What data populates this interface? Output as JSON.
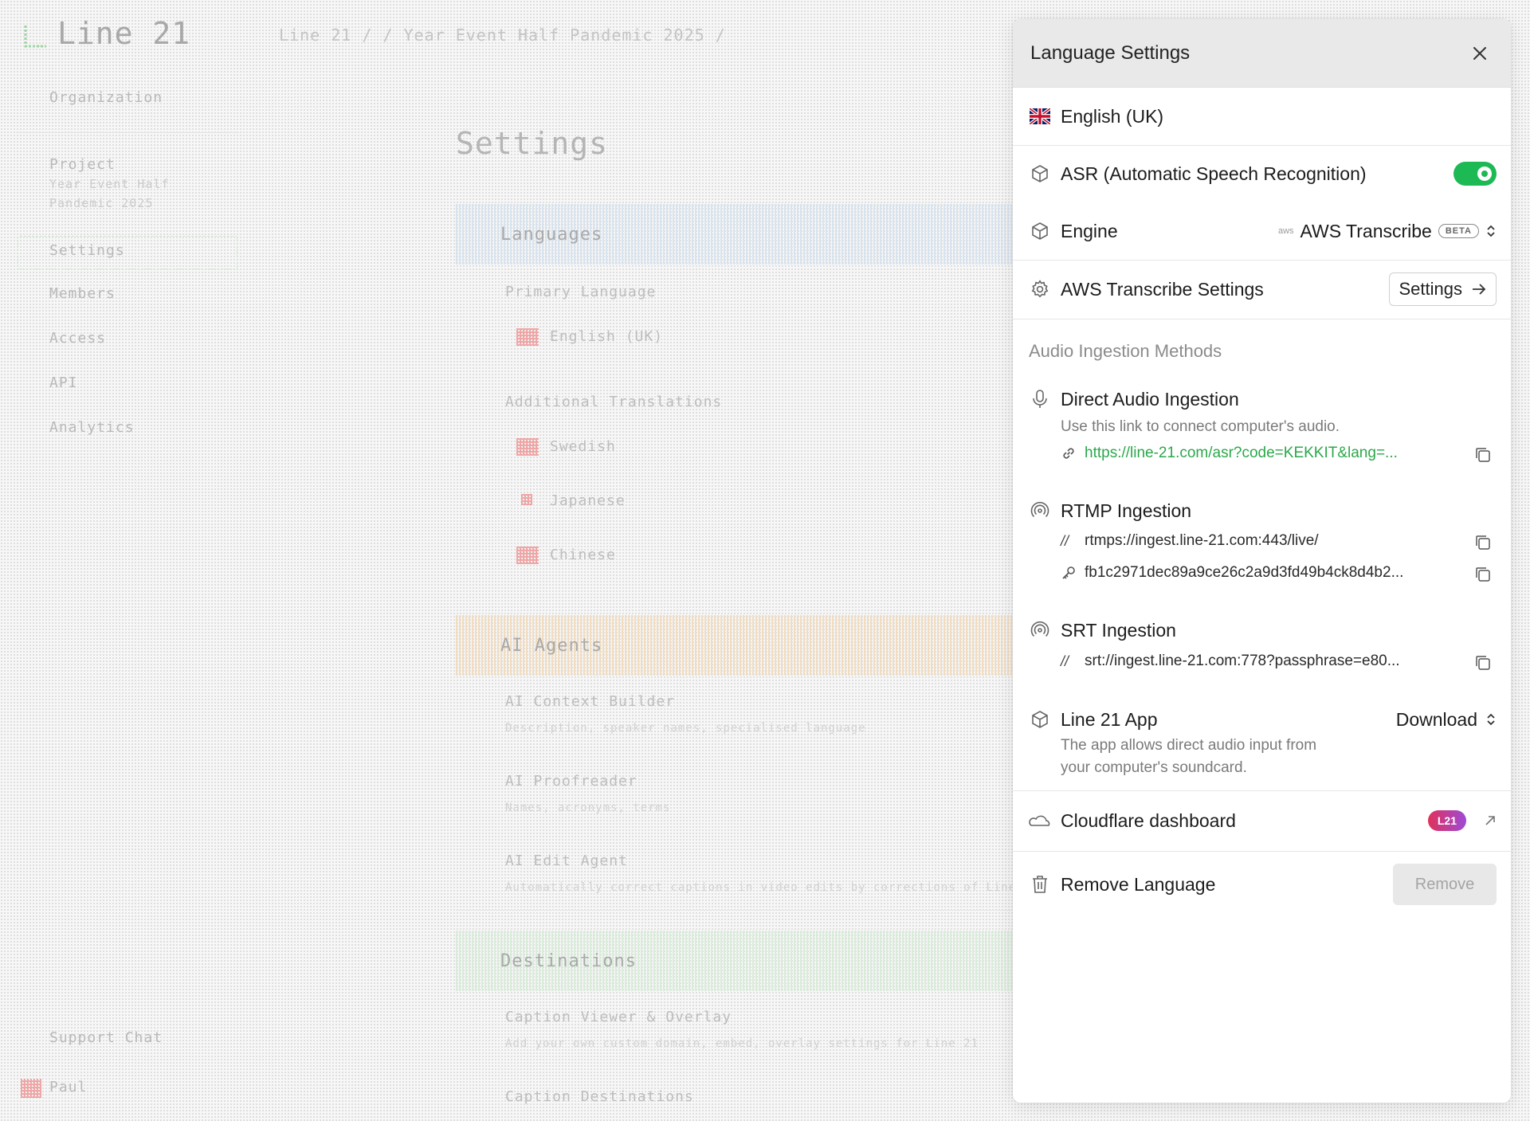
{
  "background": {
    "logo": "Line 21",
    "breadcrumb": "Line 21  /  /  Year Event Half Pandemic 2025  /",
    "sidebar": {
      "org": "Organization",
      "project": "Project",
      "project_sub1": "Year Event Half",
      "project_sub2": "Pandemic 2025",
      "items": [
        "Settings",
        "Members",
        "Access",
        "API",
        "Analytics"
      ],
      "support": "Support Chat",
      "user": "Paul"
    },
    "page_title": "Settings",
    "sections": [
      {
        "label": "Languages"
      },
      {
        "label": "AI Agents"
      },
      {
        "label": "Destinations"
      }
    ],
    "rows": {
      "primary_language": "Primary Language",
      "primary_value": "English (UK)",
      "additional": "Additional Translations",
      "lang1": "Swedish",
      "lang2": "Japanese",
      "lang3": "Chinese",
      "ai_context": "AI Context Builder",
      "ai_context_sub": "Description, speaker names, specialised language",
      "ai_proof": "AI Proofreader",
      "ai_proof_sub": "Names, acronyms, terms",
      "ai_edit": "AI Edit Agent",
      "ai_edit_sub": "Automatically correct captions in video edits by corrections of Line 21",
      "caption_viewer": "Caption Viewer & Overlay",
      "caption_viewer_sub": "Add your own custom domain, embed, overlay settings for Line 21",
      "caption_dest": "Caption Destinations"
    }
  },
  "drawer": {
    "title": "Language Settings",
    "language": "English (UK)",
    "asr_label": "ASR (Automatic Speech Recognition)",
    "asr_enabled": true,
    "engine_label": "Engine",
    "engine_value": "AWS Transcribe",
    "engine_aws_mini": "aws",
    "engine_badge": "BETA",
    "aws_settings_label": "AWS Transcribe Settings",
    "aws_settings_button": "Settings",
    "ingestion_heading": "Audio Ingestion Methods",
    "direct": {
      "title": "Direct Audio Ingestion",
      "desc": "Use this link to connect computer's audio.",
      "link": "https://line-21.com/asr?code=KEKKIT&lang=..."
    },
    "rtmp": {
      "title": "RTMP Ingestion",
      "url": "rtmps://ingest.line-21.com:443/live/",
      "key": "fb1c2971dec89a9ce26c2a9d3fd49b4ck8d4b2..."
    },
    "srt": {
      "title": "SRT Ingestion",
      "url": "srt://ingest.line-21.com:778?passphrase=e80..."
    },
    "app": {
      "title": "Line 21 App",
      "download": "Download",
      "desc1": "The app allows direct audio input from",
      "desc2": "your computer's soundcard."
    },
    "cloudflare": {
      "label": "Cloudflare dashboard",
      "badge": "L21"
    },
    "remove": {
      "label": "Remove Language",
      "button": "Remove"
    },
    "colors": {
      "accent_green": "#1db954",
      "link_green": "#2ba84a",
      "badge_gradient_start": "#e0315a",
      "badge_gradient_end": "#9d4bd8"
    }
  }
}
